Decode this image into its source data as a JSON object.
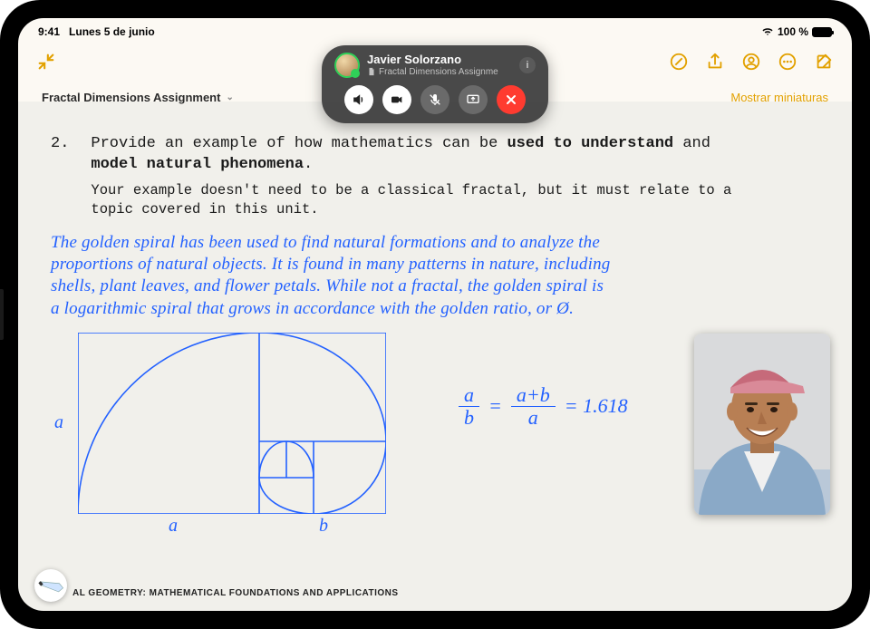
{
  "status": {
    "time": "9:41",
    "date": "Lunes 5 de junio",
    "battery": "100 %"
  },
  "toolbar": {
    "icons": {
      "collapse": "collapse-icon",
      "annotate": "markup-icon",
      "share": "share-icon",
      "collaborate": "collaborators-icon",
      "more": "more-icon",
      "compose": "compose-icon"
    }
  },
  "doc": {
    "title": "Fractal Dimensions Assignment",
    "thumbs": "Mostrar miniaturas"
  },
  "question": {
    "number": "2.",
    "text_a": "Provide an example of how mathematics can be ",
    "text_b_bold": "used to understand",
    "text_c": " and ",
    "text_d_bold": "model natural phenomena",
    "text_e": ".",
    "subtext": "Your example doesn't need to be a classical fractal, but it must relate to a topic covered in this unit."
  },
  "answer": {
    "line1": "The golden spiral has been used to find natural formations and to analyze the",
    "line2": "proportions of natural objects. It is found in many patterns in nature, including",
    "line3": "shells, plant leaves, and flower petals. While not a fractal, the golden spiral is",
    "line4": "a logarithmic spiral that grows in accordance with the golden ratio, or Ø."
  },
  "figure": {
    "label_a": "a",
    "label_b": "b",
    "eq_ab_num": "a",
    "eq_ab_den": "b",
    "eq_mid": "=",
    "eq_ab2_num": "a+b",
    "eq_ab2_den": "a",
    "eq_val": "= 1.618"
  },
  "footer": "AL GEOMETRY: MATHEMATICAL FOUNDATIONS AND APPLICATIONS",
  "call": {
    "name": "Javier Solorzano",
    "sub": "Fractal Dimensions Assignme",
    "info": "i"
  }
}
